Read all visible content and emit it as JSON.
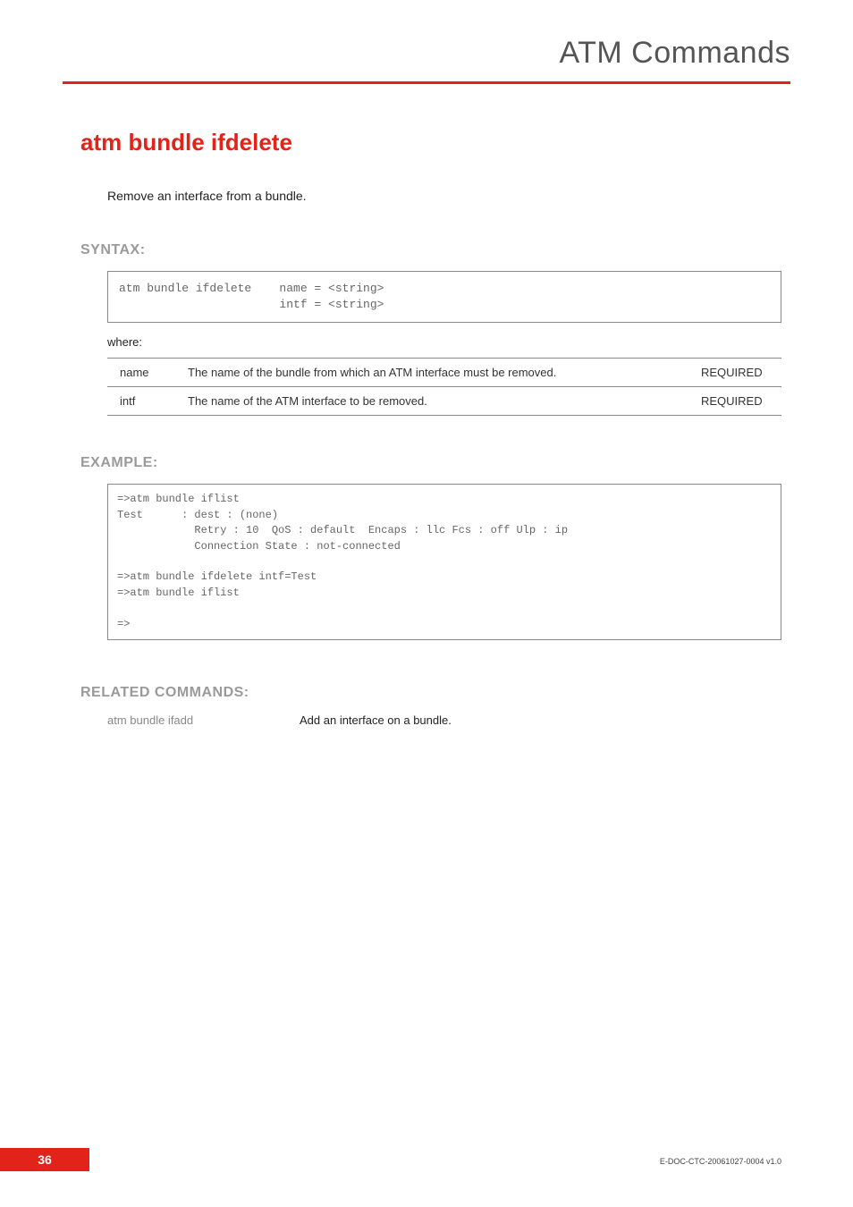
{
  "header": {
    "title": "ATM Commands"
  },
  "command": {
    "title": "atm bundle ifdelete",
    "description": "Remove an interface from a bundle."
  },
  "syntax": {
    "label": "SYNTAX:",
    "code": "atm bundle ifdelete    name = <string>\n                       intf = <string>",
    "where": "where:",
    "params": [
      {
        "name": "name",
        "desc": "The name of the bundle from which an ATM interface must be removed.",
        "req": "REQUIRED"
      },
      {
        "name": "intf",
        "desc": "The name of the ATM interface to be removed.",
        "req": "REQUIRED"
      }
    ]
  },
  "example": {
    "label": "EXAMPLE:",
    "code": "=>atm bundle iflist\nTest      : dest : (none)\n            Retry : 10  QoS : default  Encaps : llc Fcs : off Ulp : ip\n            Connection State : not-connected\n\n=>atm bundle ifdelete intf=Test\n=>atm bundle iflist\n\n=>"
  },
  "related": {
    "label": "RELATED COMMANDS:",
    "rows": [
      {
        "cmd": "atm bundle ifadd",
        "desc": "Add an interface on a bundle."
      }
    ]
  },
  "footer": {
    "page": "36",
    "doccode": "E-DOC-CTC-20061027-0004 v1.0"
  }
}
